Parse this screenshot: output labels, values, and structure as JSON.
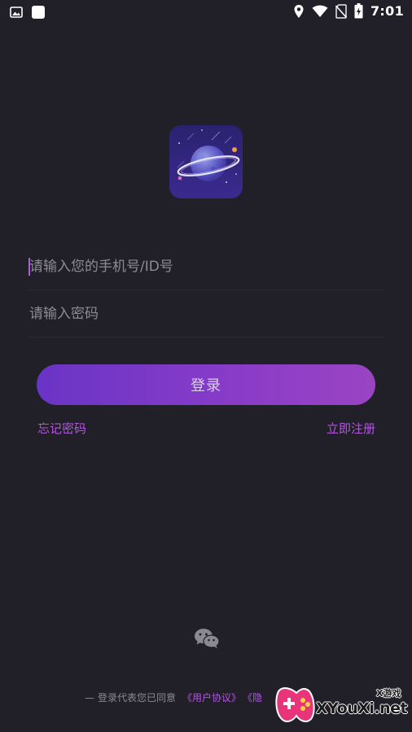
{
  "status_bar": {
    "time": "7:01",
    "icons": [
      "image-icon",
      "notification-square-icon",
      "location-icon",
      "wifi-icon",
      "no-sim-icon",
      "battery-charging-icon"
    ]
  },
  "app": {
    "logo_icon": "planet-logo-icon"
  },
  "login_form": {
    "phone_placeholder": "请输入您的手机号/ID号",
    "password_placeholder": "请输入密码",
    "login_label": "登录",
    "forgot_label": "忘记密码",
    "register_label": "立即注册"
  },
  "social": {
    "wechat_icon": "wechat-icon"
  },
  "agreement": {
    "dash": "—",
    "prefix": "登录代表您已同意",
    "user_agreement": "《用户协议》",
    "privacy": "《隐"
  },
  "watermark": {
    "brand": "XYouXi.net",
    "tag": "X游戏"
  },
  "colors": {
    "background": "#211f27",
    "accent": "#b157de",
    "button_start": "#6a34c6",
    "button_end": "#9a44c2"
  }
}
